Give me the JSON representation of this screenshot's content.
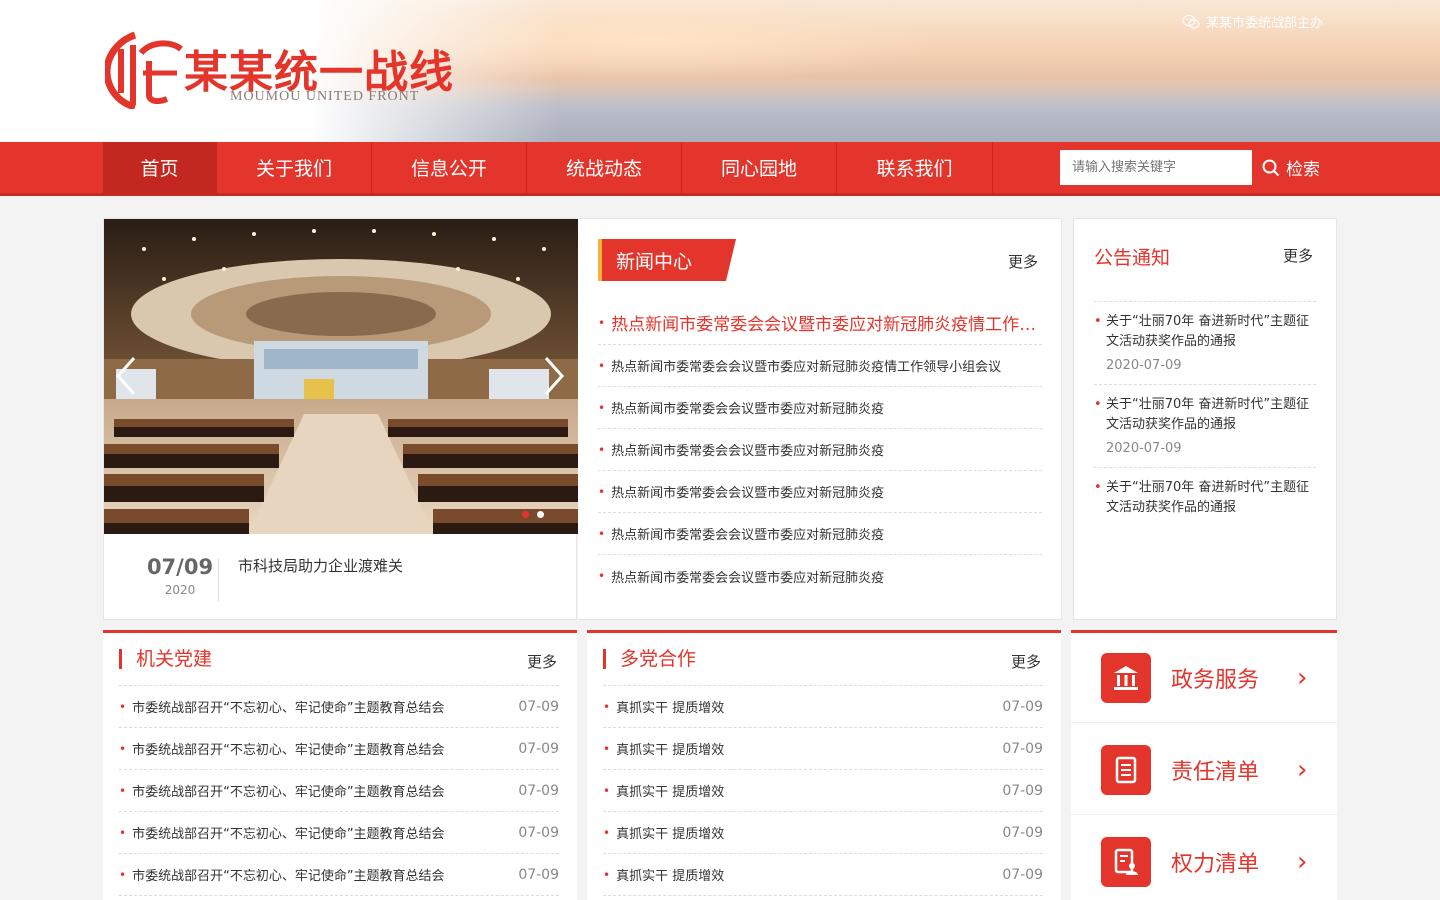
{
  "header": {
    "logo_title": "某某统一战线",
    "logo_subtitle": "MOUMOU UNITED FRONT",
    "sponsor": "某某市委统战部主办",
    "sponsor_icon": "wechat-icon"
  },
  "nav": {
    "items": [
      "首页",
      "关于我们",
      "信息公开",
      "统战动态",
      "同心园地",
      "联系我们"
    ],
    "active_index": 0,
    "search_placeholder": "请输入搜索关键字",
    "search_label": "检索"
  },
  "slider": {
    "caption_date": "07/09",
    "caption_year": "2020",
    "caption_text": "市科技局助力企业渡难关",
    "slide_count": 2,
    "active_slide": 1
  },
  "news": {
    "tab_label": "新闻中心",
    "more": "更多",
    "hot_item": "热点新闻市委常委会会议暨市委应对新冠肺炎疫情工作领导小组会议",
    "items": [
      "热点新闻市委常委会会议暨市委应对新冠肺炎疫情工作领导小组会议",
      "热点新闻市委常委会会议暨市委应对新冠肺炎疫",
      "热点新闻市委常委会会议暨市委应对新冠肺炎疫",
      "热点新闻市委常委会会议暨市委应对新冠肺炎疫",
      "热点新闻市委常委会会议暨市委应对新冠肺炎疫",
      "热点新闻市委常委会会议暨市委应对新冠肺炎疫"
    ]
  },
  "notice": {
    "title": "公告通知",
    "more": "更多",
    "items": [
      {
        "text": "关于“壮丽70年 奋进新时代”主题征文活动获奖作品的通报",
        "date": "2020-07-09"
      },
      {
        "text": "关于“壮丽70年 奋进新时代”主题征文活动获奖作品的通报",
        "date": "2020-07-09"
      },
      {
        "text": "关于“壮丽70年 奋进新时代”主题征文活动获奖作品的通报",
        "date": ""
      }
    ]
  },
  "party": {
    "title": "机关党建",
    "more": "更多",
    "rows": [
      {
        "text": "市委统战部召开“不忘初心、牢记使命”主题教育总结会",
        "date": "07-09"
      },
      {
        "text": "市委统战部召开“不忘初心、牢记使命”主题教育总结会",
        "date": "07-09"
      },
      {
        "text": "市委统战部召开“不忘初心、牢记使命”主题教育总结会",
        "date": "07-09"
      },
      {
        "text": "市委统战部召开“不忘初心、牢记使命”主题教育总结会",
        "date": "07-09"
      },
      {
        "text": "市委统战部召开“不忘初心、牢记使命”主题教育总结会",
        "date": "07-09"
      }
    ]
  },
  "multiparty": {
    "title": "多党合作",
    "more": "更多",
    "rows": [
      {
        "text": "真抓实干 提质增效",
        "date": "07-09"
      },
      {
        "text": "真抓实干 提质增效",
        "date": "07-09"
      },
      {
        "text": "真抓实干 提质增效",
        "date": "07-09"
      },
      {
        "text": "真抓实干 提质增效",
        "date": "07-09"
      },
      {
        "text": "真抓实干 提质增效",
        "date": "07-09"
      }
    ]
  },
  "services": [
    {
      "label": "政务服务",
      "icon": "government-building-icon"
    },
    {
      "label": "责任清单",
      "icon": "list-document-icon"
    },
    {
      "label": "权力清单",
      "icon": "form-person-icon"
    }
  ],
  "colors": {
    "accent": "#e3352b",
    "accent_dark": "#c2281f",
    "tab_marker": "#f2b33d"
  }
}
